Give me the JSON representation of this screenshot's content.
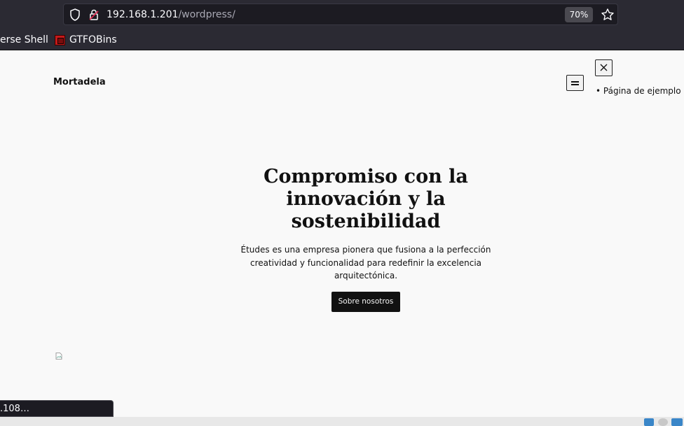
{
  "browser": {
    "url_host": "192.168.1.201",
    "url_path": "/wordpress/",
    "zoom": "70%",
    "bookmarks": [
      "erse Shell",
      "GTFOBins"
    ]
  },
  "site": {
    "title": "Mortadela",
    "nav_items": [
      "Página de ejemplo"
    ]
  },
  "hero": {
    "heading_lines": [
      "Compromiso con la",
      "innovación y la",
      "sostenibilidad"
    ],
    "text_lines": [
      "Études es una empresa pionera que fusiona a la perfección",
      "creatividad y funcionalidad para redefinir la excelencia",
      "arquitectónica."
    ],
    "button_label": "Sobre nosotros"
  },
  "status": {
    "link_text": ".108…"
  },
  "colors": {
    "chrome_bg": "#2b2a33",
    "urlbar_bg": "#1c1b22",
    "page_bg": "#f9f9f9",
    "button_bg": "#111111"
  }
}
